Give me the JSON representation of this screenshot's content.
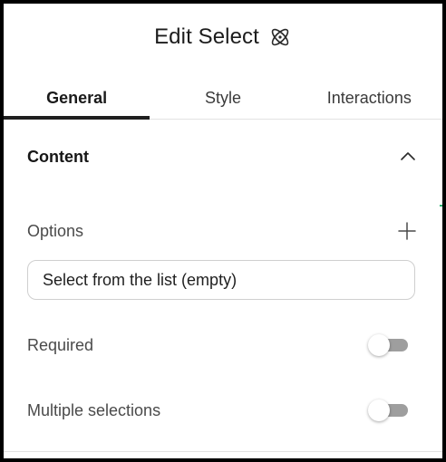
{
  "header": {
    "title": "Edit Select",
    "icon": "atom-icon"
  },
  "tabs": [
    {
      "label": "General",
      "active": true
    },
    {
      "label": "Style",
      "active": false
    },
    {
      "label": "Interactions",
      "active": false
    }
  ],
  "content": {
    "section_title": "Content",
    "expanded": true,
    "options": {
      "label": "Options",
      "add_icon": "plus-icon",
      "select_value": "Select from the list (empty)"
    },
    "required": {
      "label": "Required",
      "enabled": false
    },
    "multiple": {
      "label": "Multiple selections",
      "enabled": false
    }
  },
  "colors": {
    "text": "#1f1f1f",
    "muted_text": "#4a4a4a",
    "toggle_off": "#9e9e9e",
    "border": "#cfcfcf",
    "accent": "#2bb673"
  }
}
